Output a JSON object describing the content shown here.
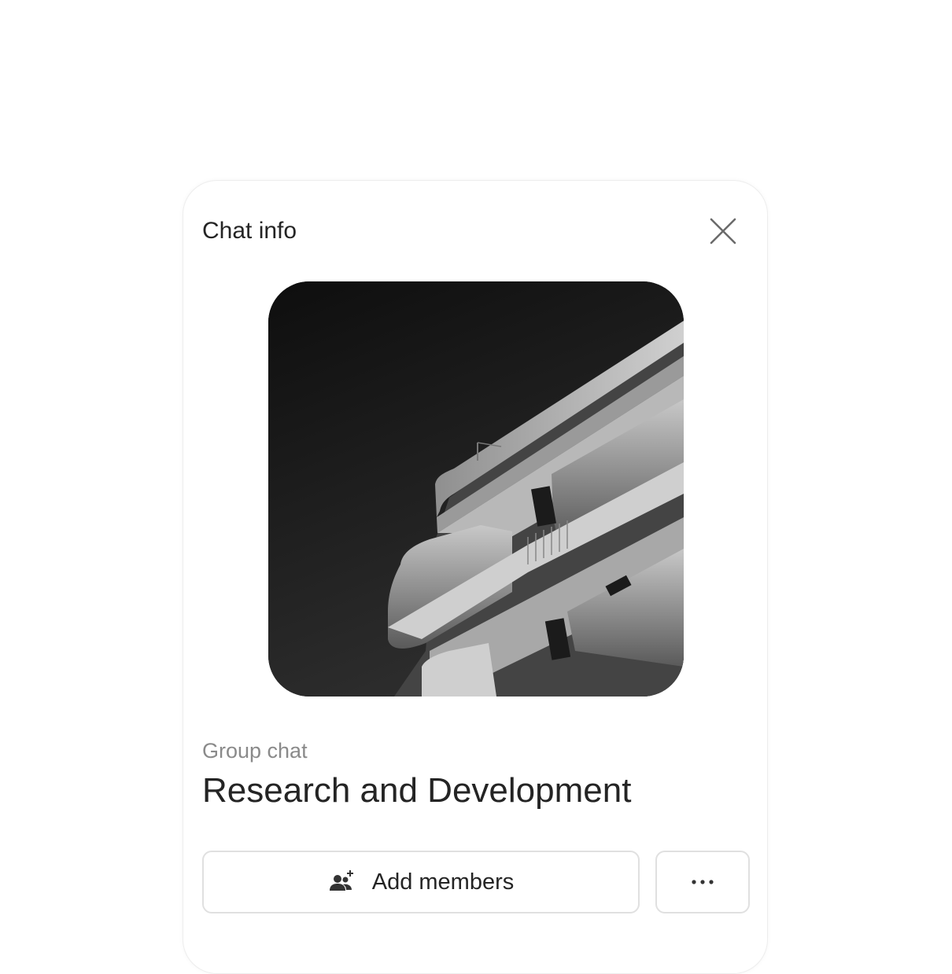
{
  "header": {
    "title": "Chat info"
  },
  "icons": {
    "close": "close-icon",
    "add_members": "person-add-icon",
    "more": "more-horizontal-icon"
  },
  "chat": {
    "type_label": "Group chat",
    "name": "Research and Development",
    "avatar_description": "group-avatar-image"
  },
  "actions": {
    "add_members_label": "Add members"
  },
  "colors": {
    "text_primary": "#242424",
    "text_secondary": "#8a8a8a",
    "border": "#e0e0e0"
  }
}
